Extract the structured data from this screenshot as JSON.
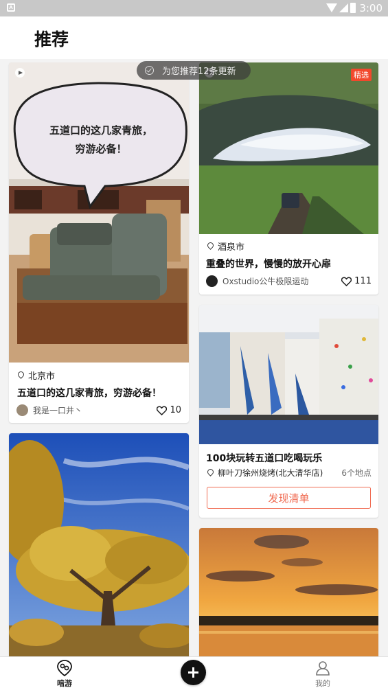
{
  "status_bar": {
    "time": "3:00"
  },
  "header": {
    "title": "推荐"
  },
  "toast": {
    "text": "为您推荐12条更新"
  },
  "cards": {
    "beijing": {
      "location": "北京市",
      "bubble_line1": "五道口的这几家青旅，",
      "bubble_line2": "穷游必备！",
      "title": "五道口的这几家青旅，穷游必备！",
      "author": "我是一口井丶",
      "likes": "10",
      "icon": "play-icon"
    },
    "jiuquan": {
      "badge": "精选",
      "location": "酒泉市",
      "title": "重叠的世界，慢慢的放开心扉",
      "author": "Oxstudio公牛极限运动",
      "likes": "111"
    },
    "climbing": {
      "title": "100块玩转五道口吃喝玩乐",
      "place": "柳叶刀徐州烧烤(北大清华店)",
      "spots": "6个地点",
      "button": "发现清单"
    }
  },
  "nav": {
    "home_label": "喑游",
    "me_label": "我的"
  },
  "colors": {
    "accent": "#f06a50",
    "badge": "#f2482c"
  }
}
